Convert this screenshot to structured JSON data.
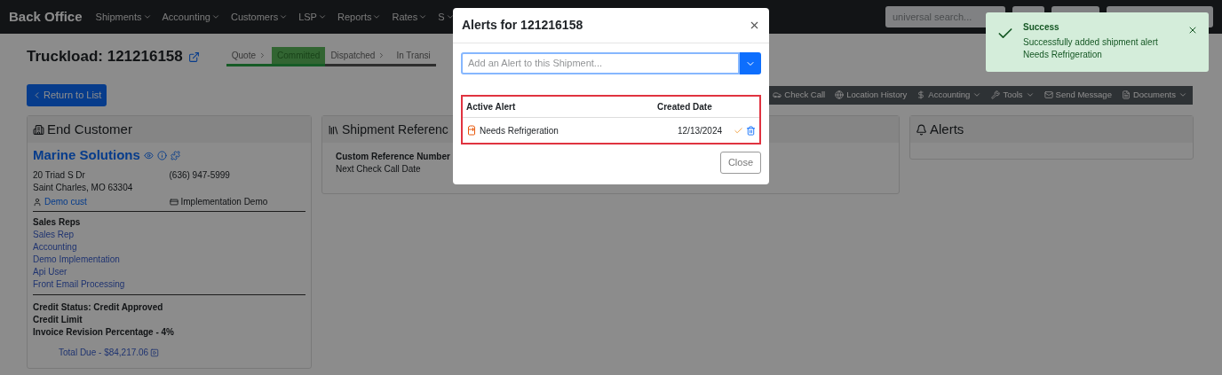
{
  "nav": {
    "brand": "Back Office",
    "menus": [
      {
        "label": "Shipments"
      },
      {
        "label": "Accounting"
      },
      {
        "label": "Customers"
      },
      {
        "label": "LSP"
      },
      {
        "label": "Reports"
      },
      {
        "label": "Rates"
      },
      {
        "label": "S"
      }
    ],
    "search": {
      "placeholder": "universal search..."
    }
  },
  "page": {
    "title": "Truckload: 121216158",
    "steps": [
      {
        "label": "Quote",
        "selected": false,
        "completed": true
      },
      {
        "label": "Committed",
        "selected": true,
        "completed": true
      },
      {
        "label": "Dispatched",
        "selected": false,
        "completed": false
      },
      {
        "label": "In Transi",
        "selected": false,
        "completed": false
      }
    ],
    "return_button": "Return to List",
    "toolbar": [
      {
        "label": "Check Call",
        "dropdown": false
      },
      {
        "label": "Location History",
        "dropdown": false
      },
      {
        "label": "Accounting",
        "dropdown": true
      },
      {
        "label": "Tools",
        "dropdown": true
      },
      {
        "label": "Send Message",
        "dropdown": false
      },
      {
        "label": "Documents",
        "dropdown": true
      }
    ]
  },
  "end_customer": {
    "title": "End Customer",
    "name": "Marine Solutions",
    "address": [
      "20 Triad S Dr",
      "Saint Charles, MO 63304"
    ],
    "phone": "(636) 947-5999",
    "contact": "Demo cust",
    "account": "Implementation Demo",
    "sales_reps_title": "Sales Reps",
    "sales_reps": [
      "Sales Rep",
      "Accounting",
      "Demo Implementation",
      "Api User",
      "Front Email Processing"
    ],
    "credit": [
      "Credit Status: Credit Approved",
      "Credit Limit",
      "Invoice Revision Percentage - 4%"
    ],
    "total_due": "Total Due - $84,217.06"
  },
  "shipment_reference": {
    "title": "Shipment Referenc",
    "fields": [
      "Custom Reference Number",
      "Next Check Call Date"
    ]
  },
  "alerts_panel": {
    "title": "Alerts"
  },
  "modal": {
    "title": "Alerts for 121216158",
    "input": {
      "placeholder": "Add an Alert to this Shipment..."
    },
    "columns": [
      "Active Alert",
      "Created Date"
    ],
    "rows": [
      {
        "alert": "Needs Refrigeration",
        "date": "12/13/2024"
      }
    ],
    "close": "Close"
  },
  "toast": {
    "title": "Success",
    "lines": [
      "Successfully added shipment alert",
      "Needs Refrigeration"
    ]
  }
}
